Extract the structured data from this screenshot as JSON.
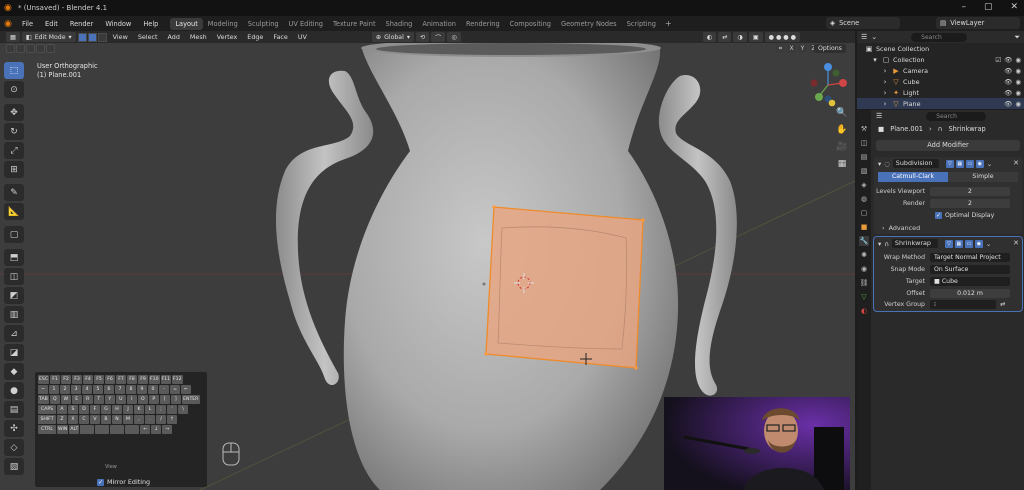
{
  "titlebar": {
    "title": "* (Unsaved) - Blender 4.1"
  },
  "menus": [
    "File",
    "Edit",
    "Render",
    "Window",
    "Help"
  ],
  "workspaces": [
    "Layout",
    "Modeling",
    "Sculpting",
    "UV Editing",
    "Texture Paint",
    "Shading",
    "Animation",
    "Rendering",
    "Compositing",
    "Geometry Nodes",
    "Scripting"
  ],
  "active_workspace": "Layout",
  "scene_name": "Scene",
  "view_layer": "ViewLayer",
  "viewport": {
    "mode": "Edit Mode",
    "menus": [
      "View",
      "Select",
      "Add",
      "Mesh",
      "Vertex",
      "Edge",
      "Face",
      "UV"
    ],
    "orientation": "Global",
    "view_name": "User Orthographic",
    "object_info": "(1) Plane.001",
    "axis_toggles": [
      "X",
      "Y",
      "Z"
    ],
    "options_label": "Options"
  },
  "outliner": {
    "search_placeholder": "Search",
    "items": [
      {
        "label": "Scene Collection"
      },
      {
        "label": "Collection"
      },
      {
        "label": "Camera"
      },
      {
        "label": "Cube"
      },
      {
        "label": "Light"
      },
      {
        "label": "Plane"
      }
    ]
  },
  "properties": {
    "search_placeholder": "Search",
    "object": "Plane.001",
    "modifier_crumb": "Shrinkwrap",
    "add_modifier": "Add Modifier",
    "subdivision": {
      "name": "Subdivision",
      "types": [
        "Catmull-Clark",
        "Simple"
      ],
      "active_type": "Catmull-Clark",
      "levels_viewport_label": "Levels Viewport",
      "levels_viewport": "2",
      "render_label": "Render",
      "render": "2",
      "optimal_display": "Optimal Display",
      "advanced": "Advanced"
    },
    "shrinkwrap": {
      "name": "Shrinkwrap",
      "wrap_method_label": "Wrap Method",
      "wrap_method": "Target Normal Project",
      "snap_mode_label": "Snap Mode",
      "snap_mode": "On Surface",
      "target_label": "Target",
      "target": "Cube",
      "offset_label": "Offset",
      "offset": "0.012 m",
      "vertex_group_label": "Vertex Group",
      "vertex_group": ""
    }
  },
  "keyboard": {
    "rows": [
      [
        "ESC",
        "F1",
        "F2",
        "F3",
        "F4",
        "F5",
        "F6",
        "F7",
        "F8",
        "F9",
        "F10",
        "F11",
        "F12"
      ],
      [
        "~",
        "1",
        "2",
        "3",
        "4",
        "5",
        "6",
        "7",
        "8",
        "9",
        "0",
        "-",
        "=",
        "←"
      ],
      [
        "TAB",
        "Q",
        "W",
        "E",
        "R",
        "T",
        "Y",
        "U",
        "I",
        "O",
        "P",
        "[",
        "]",
        "ENTER"
      ],
      [
        "CAPS",
        "A",
        "S",
        "D",
        "F",
        "G",
        "H",
        "J",
        "K",
        "L",
        ";",
        "'",
        "\\"
      ],
      [
        "SHIFT",
        "Z",
        "X",
        "C",
        "V",
        "B",
        "N",
        "M",
        ",",
        ".",
        "/",
        "↑"
      ],
      [
        "CTRL",
        "WIN",
        "ALT",
        "",
        "",
        "",
        "",
        "←",
        "↓",
        "→"
      ]
    ],
    "overlay_text": "View"
  },
  "mirror_editing": "Mirror Editing"
}
